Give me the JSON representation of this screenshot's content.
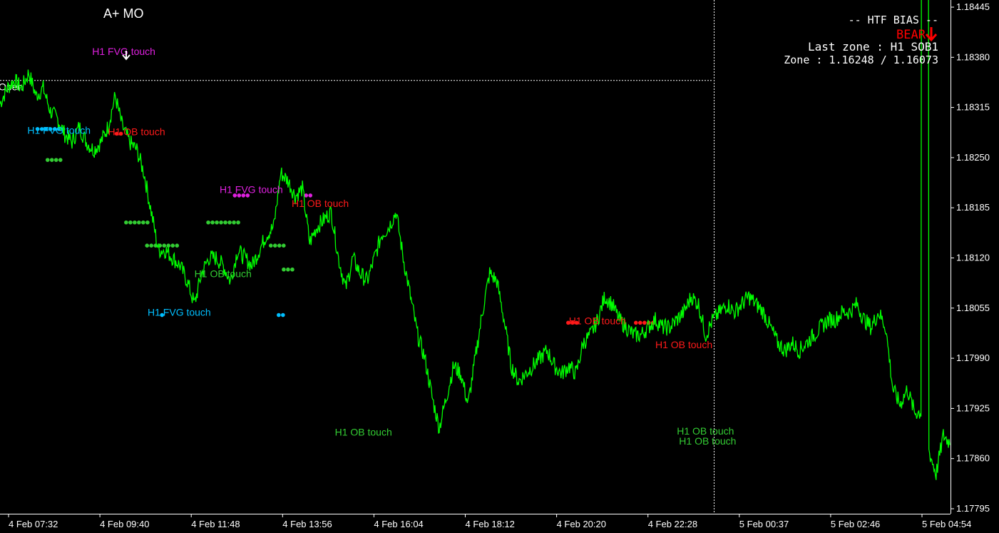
{
  "indicator_title": "A+ MO",
  "open_label": "Open",
  "hud": {
    "heading": "-- HTF BIAS --",
    "bias": "BEAR",
    "last_zone": "Last zone : H1 SOB1",
    "zone": "Zone : 1.16248 / 1.16073"
  },
  "colors": {
    "price": "#00ff00",
    "fvg_bull": "#00bfff",
    "fvg_bear": "#e020e0",
    "ob_bull": "#33cc33",
    "ob_bear": "#ff1a1a",
    "bias_bear": "#ff0000",
    "axis": "#ffffff"
  },
  "icons": {
    "bias_arrow": "arrow-down-icon",
    "signal_arrow": "arrow-down-icon"
  },
  "chart_data": {
    "type": "line",
    "price_axis": {
      "ticks": [
        "1.18445",
        "1.18380",
        "1.18315",
        "1.18250",
        "1.18185",
        "1.18120",
        "1.18055",
        "1.17990",
        "1.17925",
        "1.17860",
        "1.17795"
      ],
      "range": [
        1.1775,
        1.1849
      ]
    },
    "time_axis": {
      "ticks": [
        "4 Feb 07:32",
        "4 Feb 09:40",
        "4 Feb 11:48",
        "4 Feb 13:56",
        "4 Feb 16:04",
        "4 Feb 18:12",
        "4 Feb 20:20",
        "4 Feb 22:28",
        "5 Feb 00:37",
        "5 Feb 02:46",
        "5 Feb 04:54"
      ]
    },
    "open_level": 1.1835,
    "series": [
      {
        "values": [
          [
            0,
            1.1832
          ],
          [
            1,
            1.1834
          ],
          [
            2,
            1.1835
          ],
          [
            3,
            1.1834
          ],
          [
            4,
            1.1836
          ],
          [
            5,
            1.1833
          ],
          [
            6,
            1.1834
          ],
          [
            7,
            1.1831
          ],
          [
            8,
            1.183
          ],
          [
            9,
            1.1828
          ],
          [
            10,
            1.1827
          ],
          [
            11,
            1.1829
          ],
          [
            12,
            1.1827
          ],
          [
            13,
            1.1826
          ],
          [
            14,
            1.1827
          ],
          [
            15,
            1.1829
          ],
          [
            16,
            1.1833
          ],
          [
            17,
            1.1829
          ],
          [
            18,
            1.1827
          ],
          [
            19,
            1.1826
          ],
          [
            20,
            1.1823
          ],
          [
            21,
            1.1818
          ],
          [
            22,
            1.1813
          ],
          [
            23,
            1.1813
          ],
          [
            24,
            1.1812
          ],
          [
            25,
            1.1811
          ],
          [
            26,
            1.1809
          ],
          [
            27,
            1.1806
          ],
          [
            28,
            1.181
          ],
          [
            29,
            1.1812
          ],
          [
            30,
            1.1812
          ],
          [
            31,
            1.1811
          ],
          [
            32,
            1.1809
          ],
          [
            33,
            1.1813
          ],
          [
            34,
            1.1812
          ],
          [
            35,
            1.1811
          ],
          [
            36,
            1.1813
          ],
          [
            37,
            1.1815
          ],
          [
            38,
            1.1816
          ],
          [
            39,
            1.1823
          ],
          [
            40,
            1.1822
          ],
          [
            41,
            1.182
          ],
          [
            42,
            1.1821
          ],
          [
            43,
            1.1814
          ],
          [
            44,
            1.1816
          ],
          [
            45,
            1.1817
          ],
          [
            46,
            1.1818
          ],
          [
            47,
            1.1812
          ],
          [
            48,
            1.1808
          ],
          [
            49,
            1.1812
          ],
          [
            50,
            1.181
          ],
          [
            51,
            1.1809
          ],
          [
            52,
            1.1812
          ],
          [
            53,
            1.1815
          ],
          [
            54,
            1.1816
          ],
          [
            55,
            1.1818
          ],
          [
            56,
            1.1812
          ],
          [
            57,
            1.1807
          ],
          [
            58,
            1.1802
          ],
          [
            59,
            1.1799
          ],
          [
            60,
            1.1794
          ],
          [
            61,
            1.179
          ],
          [
            62,
            1.1794
          ],
          [
            63,
            1.1798
          ],
          [
            64,
            1.1797
          ],
          [
            65,
            1.1793
          ],
          [
            66,
            1.1799
          ],
          [
            67,
            1.1805
          ],
          [
            68,
            1.181
          ],
          [
            69,
            1.1809
          ],
          [
            70,
            1.1804
          ],
          [
            71,
            1.1798
          ],
          [
            72,
            1.1796
          ],
          [
            73,
            1.1797
          ],
          [
            74,
            1.1798
          ],
          [
            75,
            1.1799
          ],
          [
            76,
            1.18
          ],
          [
            77,
            1.1798
          ],
          [
            78,
            1.1797
          ],
          [
            79,
            1.1798
          ],
          [
            80,
            1.1797
          ],
          [
            81,
            1.1801
          ],
          [
            82,
            1.1802
          ],
          [
            83,
            1.1804
          ],
          [
            84,
            1.1807
          ],
          [
            85,
            1.1806
          ],
          [
            86,
            1.1804
          ],
          [
            87,
            1.1803
          ],
          [
            88,
            1.1802
          ],
          [
            89,
            1.1802
          ],
          [
            90,
            1.1803
          ],
          [
            91,
            1.1804
          ],
          [
            92,
            1.1803
          ],
          [
            93,
            1.1803
          ],
          [
            94,
            1.1804
          ],
          [
            95,
            1.1805
          ],
          [
            96,
            1.1807
          ],
          [
            97,
            1.1806
          ],
          [
            98,
            1.1802
          ],
          [
            99,
            1.1804
          ],
          [
            100,
            1.1805
          ],
          [
            101,
            1.1806
          ],
          [
            102,
            1.1805
          ],
          [
            103,
            1.1806
          ],
          [
            104,
            1.1807
          ],
          [
            105,
            1.1806
          ],
          [
            106,
            1.1805
          ],
          [
            107,
            1.1803
          ],
          [
            108,
            1.1801
          ],
          [
            109,
            1.18
          ],
          [
            110,
            1.1801
          ],
          [
            111,
            1.18
          ],
          [
            112,
            1.1801
          ],
          [
            113,
            1.1802
          ],
          [
            114,
            1.1803
          ],
          [
            115,
            1.1804
          ],
          [
            116,
            1.1804
          ],
          [
            117,
            1.1805
          ],
          [
            118,
            1.1805
          ],
          [
            119,
            1.1806
          ],
          [
            120,
            1.1804
          ],
          [
            121,
            1.1803
          ],
          [
            122,
            1.1805
          ],
          [
            123,
            1.1803
          ],
          [
            124,
            1.1795
          ],
          [
            125,
            1.1793
          ],
          [
            126,
            1.1795
          ],
          [
            127,
            1.1792
          ],
          [
            128,
            1.189
          ],
          [
            129,
            1.1787
          ],
          [
            130,
            1.1784
          ],
          [
            131,
            1.1789
          ],
          [
            132,
            1.1788
          ]
        ]
      }
    ]
  },
  "annotations": [
    {
      "text": "H1 FVG touch",
      "color": "fvg_bear",
      "time": 12.8,
      "price": 1.18383
    },
    {
      "text": "H1 FVG touch",
      "color": "fvg_bull",
      "time": 3.8,
      "price": 1.18281
    },
    {
      "text": "H1 OB touch",
      "color": "ob_bear",
      "time": 15.0,
      "price": 1.18279
    },
    {
      "text": "H1 FVG touch",
      "color": "fvg_bear",
      "time": 30.5,
      "price": 1.18204
    },
    {
      "text": "H1 OB touch",
      "color": "ob_bear",
      "time": 40.5,
      "price": 1.18186
    },
    {
      "text": "H1 OB touch",
      "color": "ob_bull",
      "time": 27.0,
      "price": 1.18095
    },
    {
      "text": "H1 FVG touch",
      "color": "fvg_bull",
      "time": 20.5,
      "price": 1.18045
    },
    {
      "text": "H1 OB touch",
      "color": "ob_bull",
      "time": 46.5,
      "price": 1.1789
    },
    {
      "text": "H1 OB touch",
      "color": "ob_bear",
      "time": 79.0,
      "price": 1.18034
    },
    {
      "text": "H1 OB touch",
      "color": "ob_bear",
      "time": 91.0,
      "price": 1.18003
    },
    {
      "text": "H1 OB touch",
      "color": "ob_bull",
      "time": 94.0,
      "price": 1.17891
    },
    {
      "text": "H1 OB touch",
      "color": "ob_bull",
      "time": 94.3,
      "price": 1.17878
    }
  ],
  "markers": [
    {
      "color": "fvg_bull",
      "time": 7.0,
      "price": 1.18287,
      "count": 7
    },
    {
      "color": "fvg_bear",
      "time": 33.5,
      "price": 1.18201,
      "count": 4
    },
    {
      "color": "fvg_bear",
      "time": 42.8,
      "price": 1.18201,
      "count": 2
    },
    {
      "color": "ob_bull",
      "time": 7.5,
      "price": 1.18247,
      "count": 4
    },
    {
      "color": "ob_bull",
      "time": 19.0,
      "price": 1.18166,
      "count": 6
    },
    {
      "color": "ob_bull",
      "time": 22.5,
      "price": 1.18136,
      "count": 8
    },
    {
      "color": "ob_bull",
      "time": 31.0,
      "price": 1.18166,
      "count": 8
    },
    {
      "color": "ob_bull",
      "time": 38.5,
      "price": 1.18136,
      "count": 4
    },
    {
      "color": "ob_bull",
      "time": 40.0,
      "price": 1.18105,
      "count": 3
    },
    {
      "color": "fvg_bull",
      "time": 22.5,
      "price": 1.18046,
      "count": 1
    },
    {
      "color": "fvg_bull",
      "time": 39.0,
      "price": 1.18046,
      "count": 2
    },
    {
      "color": "ob_bear",
      "time": 16.5,
      "price": 1.18281,
      "count": 2
    },
    {
      "color": "ob_bear",
      "time": 79.5,
      "price": 1.18036,
      "count": 3
    },
    {
      "color": "ob_bear",
      "time": 89.5,
      "price": 1.18036,
      "count": 5
    }
  ]
}
